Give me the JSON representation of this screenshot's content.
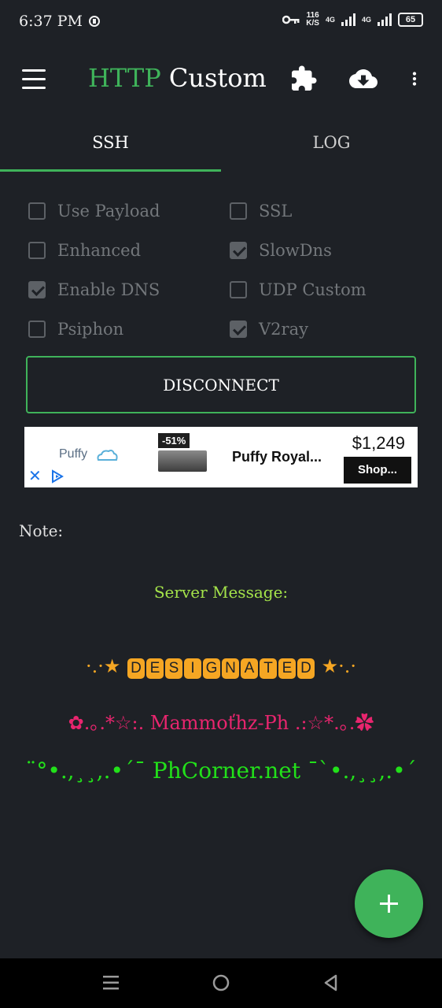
{
  "status_bar": {
    "time": "6:37 PM",
    "speed_value": "116",
    "speed_unit": "K/S",
    "network_1": "4G",
    "network_2": "4G",
    "battery": "65"
  },
  "app_bar": {
    "title_part1": "HTTP",
    "title_part2": "Custom"
  },
  "tabs": [
    {
      "label": "SSH",
      "active": true
    },
    {
      "label": "LOG",
      "active": false
    }
  ],
  "options": [
    {
      "label": "Use Payload",
      "checked": false
    },
    {
      "label": "SSL",
      "checked": false
    },
    {
      "label": "Enhanced",
      "checked": false
    },
    {
      "label": "SlowDns",
      "checked": true
    },
    {
      "label": "Enable DNS",
      "checked": true
    },
    {
      "label": "UDP Custom",
      "checked": false
    },
    {
      "label": "Psiphon",
      "checked": false
    },
    {
      "label": "V2ray",
      "checked": true
    }
  ],
  "disconnect_label": "DISCONNECT",
  "ad": {
    "brand": "Puffy",
    "discount": "-51%",
    "title": "Puffy Royal...",
    "price": "$1,249",
    "cta": "Shop..."
  },
  "note_label": "Note:",
  "server_message": {
    "heading": "Server Message:",
    "line1_prefix": "·.·★",
    "line1_tiles": [
      "D",
      "E",
      "S",
      "I",
      "G",
      "N",
      "A",
      "T",
      "E",
      "D"
    ],
    "line1_suffix": "★·.·",
    "line2": "✿.｡.*☆:. Mammoťhz-Ph .:☆*.｡.✿",
    "line3": "¨°•.,¸¸,.•´¯ PhCorner.net ¯`•.,¸¸,.•´"
  },
  "colors": {
    "accent": "#3fb35a",
    "background": "#1e2126",
    "option_text": "#73777b",
    "server_heading": "#a4e34a",
    "designated": "#f5a623",
    "mammoth": "#e8256e",
    "phcorner": "#22e01a"
  },
  "icons": [
    "menu-icon",
    "extension-icon",
    "cloud-download-icon",
    "more-vert-icon",
    "add-icon",
    "nav-menu-icon",
    "nav-home-icon",
    "nav-back-icon"
  ]
}
